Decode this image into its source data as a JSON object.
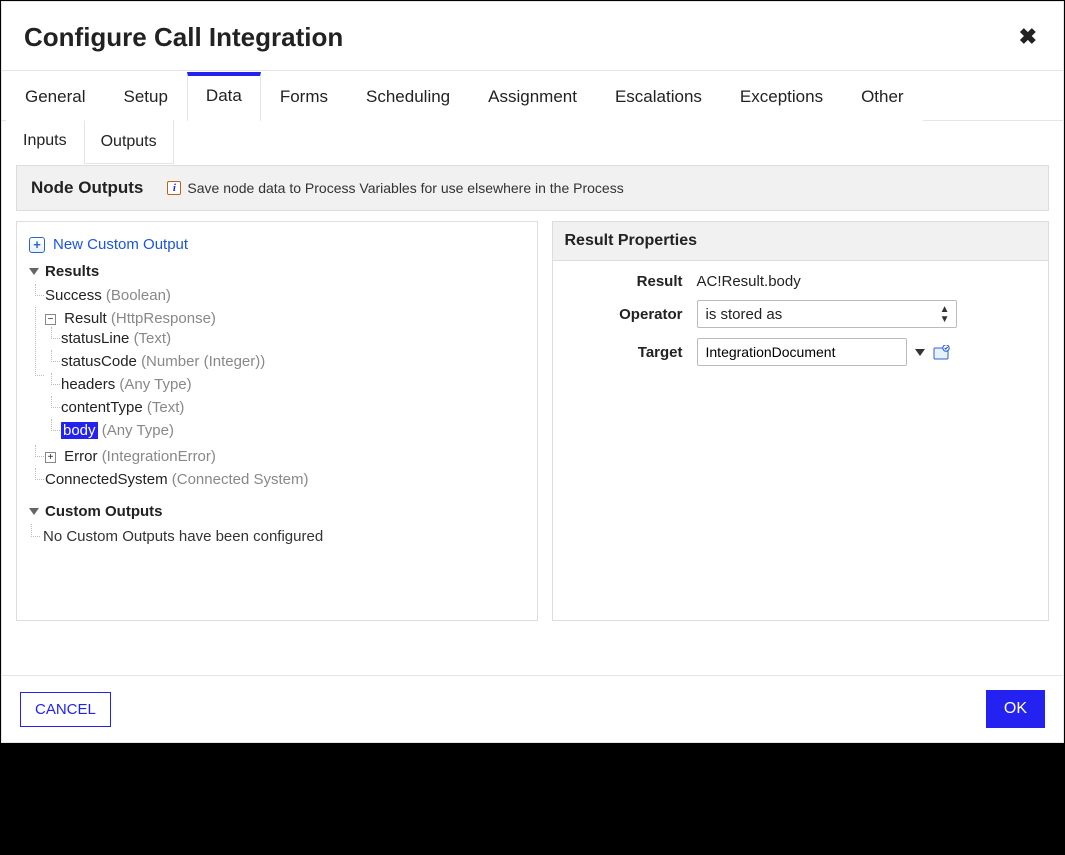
{
  "dialog": {
    "title": "Configure Call Integration"
  },
  "tabs": {
    "primary": [
      "General",
      "Setup",
      "Data",
      "Forms",
      "Scheduling",
      "Assignment",
      "Escalations",
      "Exceptions",
      "Other"
    ],
    "primary_active": "Data",
    "secondary": [
      "Inputs",
      "Outputs"
    ],
    "secondary_active": "Outputs"
  },
  "section": {
    "title": "Node Outputs",
    "hint": "Save node data to Process Variables for use elsewhere in the Process"
  },
  "left": {
    "new_output": "New Custom Output",
    "results_label": "Results",
    "custom_label": "Custom Outputs",
    "no_custom": "No Custom Outputs have been configured",
    "tree": {
      "success": {
        "name": "Success",
        "type": "(Boolean)"
      },
      "result": {
        "name": "Result",
        "type": "(HttpResponse)",
        "children": [
          {
            "name": "statusLine",
            "type": "(Text)"
          },
          {
            "name": "statusCode",
            "type": "(Number (Integer))"
          },
          {
            "name": "headers",
            "type": "(Any Type)"
          },
          {
            "name": "contentType",
            "type": "(Text)"
          },
          {
            "name": "body",
            "type": "(Any Type)",
            "selected": true
          }
        ]
      },
      "error": {
        "name": "Error",
        "type": "(IntegrationError)"
      },
      "connected": {
        "name": "ConnectedSystem",
        "type": "(Connected System)"
      }
    }
  },
  "right": {
    "title": "Result Properties",
    "labels": {
      "result": "Result",
      "operator": "Operator",
      "target": "Target"
    },
    "result_value": "AC!Result.body",
    "operator_value": "is stored as",
    "target_value": "IntegrationDocument"
  },
  "footer": {
    "cancel": "CANCEL",
    "ok": "OK"
  }
}
